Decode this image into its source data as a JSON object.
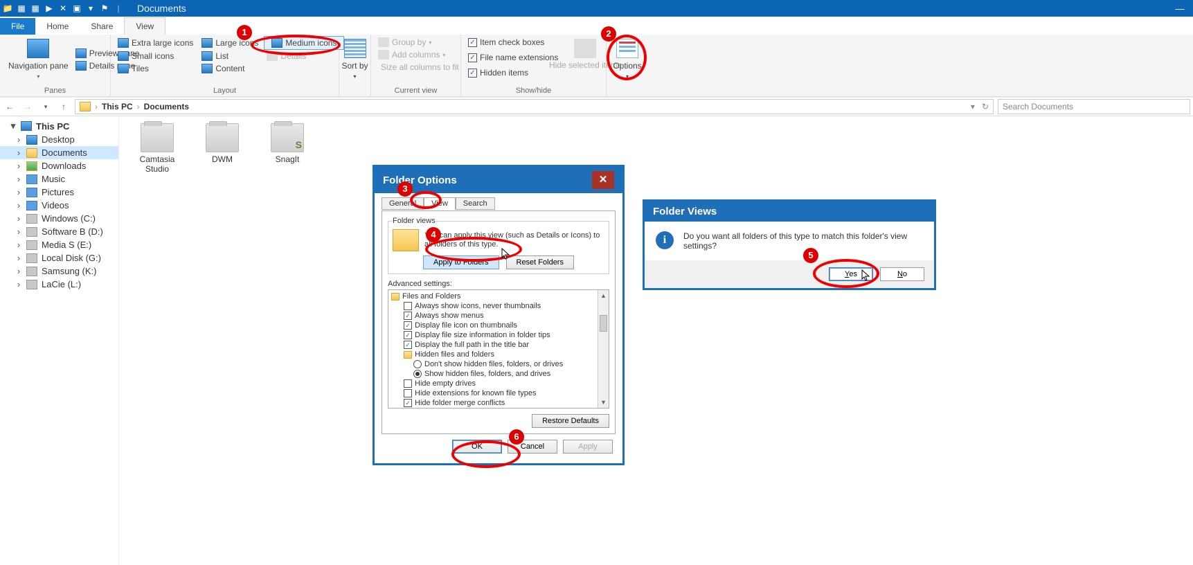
{
  "titlebar": {
    "title": "Documents"
  },
  "tabs": {
    "file": "File",
    "home": "Home",
    "share": "Share",
    "view": "View"
  },
  "ribbon": {
    "panes": {
      "label": "Panes",
      "navigation": "Navigation pane",
      "preview": "Preview pane",
      "details": "Details pane"
    },
    "layout": {
      "label": "Layout",
      "extra_large": "Extra large icons",
      "large": "Large icons",
      "medium": "Medium icons",
      "small": "Small icons",
      "list": "List",
      "details": "Details",
      "tiles": "Tiles",
      "content": "Content"
    },
    "sort": {
      "label": "Sort by"
    },
    "currentview": {
      "label": "Current view",
      "group": "Group by",
      "addcols": "Add columns",
      "sizecols": "Size all columns to fit"
    },
    "showhide": {
      "label": "Show/hide",
      "itemcheck": "Item check boxes",
      "fne": "File name extensions",
      "hidden": "Hidden items",
      "hidesel": "Hide selected items"
    },
    "options": "Options"
  },
  "address": {
    "thispc": "This PC",
    "documents": "Documents",
    "search_placeholder": "Search Documents"
  },
  "nav": {
    "thispc": "This PC",
    "desktop": "Desktop",
    "documents": "Documents",
    "downloads": "Downloads",
    "music": "Music",
    "pictures": "Pictures",
    "videos": "Videos",
    "drives": [
      "Windows (C:)",
      "Software B (D:)",
      "Media S (E:)",
      "Local Disk (G:)",
      "Samsung (K:)",
      "LaCie (L:)"
    ]
  },
  "folders": [
    {
      "name": "Camtasia Studio"
    },
    {
      "name": "DWM"
    },
    {
      "name": "SnagIt"
    }
  ],
  "folderoptions": {
    "title": "Folder Options",
    "tabs": {
      "general": "General",
      "view": "View",
      "search": "Search"
    },
    "folderviews_legend": "Folder views",
    "hint": "You can apply this view (such as Details or Icons) to all folders of this type.",
    "apply_to_folders": "Apply to Folders",
    "reset_folders": "Reset Folders",
    "advanced_label": "Advanced settings:",
    "adv": {
      "root": "Files and Folders",
      "items": [
        {
          "label": "Always show icons, never thumbnails",
          "checked": false
        },
        {
          "label": "Always show menus",
          "checked": true
        },
        {
          "label": "Display file icon on thumbnails",
          "checked": true
        },
        {
          "label": "Display file size information in folder tips",
          "checked": true
        },
        {
          "label": "Display the full path in the title bar",
          "checked": true
        }
      ],
      "hidden_group": "Hidden files and folders",
      "radios": [
        {
          "label": "Don't show hidden files, folders, or drives",
          "selected": false
        },
        {
          "label": "Show hidden files, folders, and drives",
          "selected": true
        }
      ],
      "items2": [
        {
          "label": "Hide empty drives",
          "checked": false
        },
        {
          "label": "Hide extensions for known file types",
          "checked": false
        },
        {
          "label": "Hide folder merge conflicts",
          "checked": true
        }
      ]
    },
    "restore": "Restore Defaults",
    "ok": "OK",
    "cancel": "Cancel",
    "apply": "Apply"
  },
  "confirm": {
    "title": "Folder Views",
    "msg": "Do you want all folders of this type to match this folder's view settings?",
    "yes": "Yes",
    "no": "No"
  },
  "callouts": {
    "1": "1",
    "2": "2",
    "3": "3",
    "4": "4",
    "5": "5",
    "6": "6"
  }
}
